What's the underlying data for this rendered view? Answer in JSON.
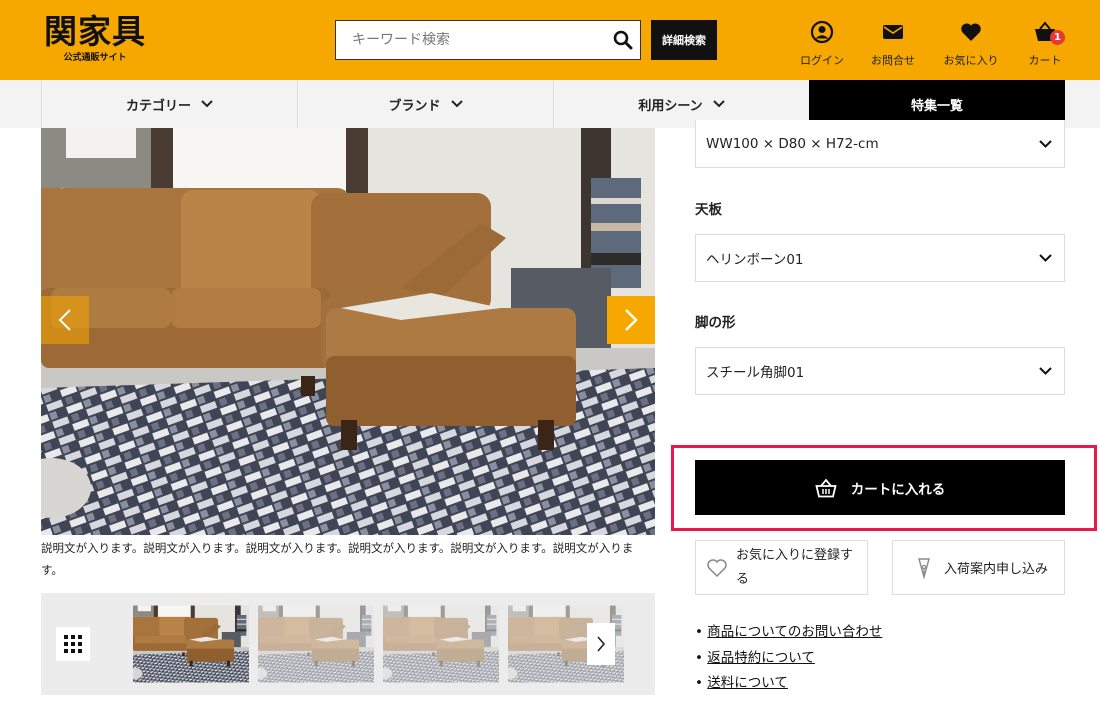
{
  "header": {
    "logo_main": "関家具",
    "logo_sub": "公式通販サイト",
    "search_placeholder": "キーワード検索",
    "advanced_search_label": "詳細検索",
    "nav": [
      {
        "label": "ログイン",
        "icon": "user-circle-icon"
      },
      {
        "label": "お問合せ",
        "icon": "envelope-icon"
      },
      {
        "label": "お気に入り",
        "icon": "heart-icon"
      },
      {
        "label": "カート",
        "icon": "cart-icon",
        "badge": "1"
      }
    ],
    "brand_color": "#f6a800"
  },
  "catnav": {
    "items": [
      {
        "label": "カテゴリー"
      },
      {
        "label": "ブランド"
      },
      {
        "label": "利用シーン"
      },
      {
        "label": "特集一覧"
      }
    ]
  },
  "gallery": {
    "caption": "説明文が入ります。説明文が入ります。説明文が入ります。説明文が入ります。説明文が入ります。説明文が入ります。"
  },
  "options": {
    "size_value": "WW100 × D80 × H72-cm",
    "top_label": "天板",
    "top_value": "ヘリンボーン01",
    "leg_label": "脚の形",
    "leg_value": "スチール角脚01"
  },
  "actions": {
    "cart_label": "カートに入れる",
    "favorite_label": "お気に入りに登録する",
    "restock_label": "入荷案内申し込み",
    "highlight_color": "#e8194d"
  },
  "links": [
    "商品についてのお問い合わせ",
    "返品特約について",
    "送料について"
  ]
}
